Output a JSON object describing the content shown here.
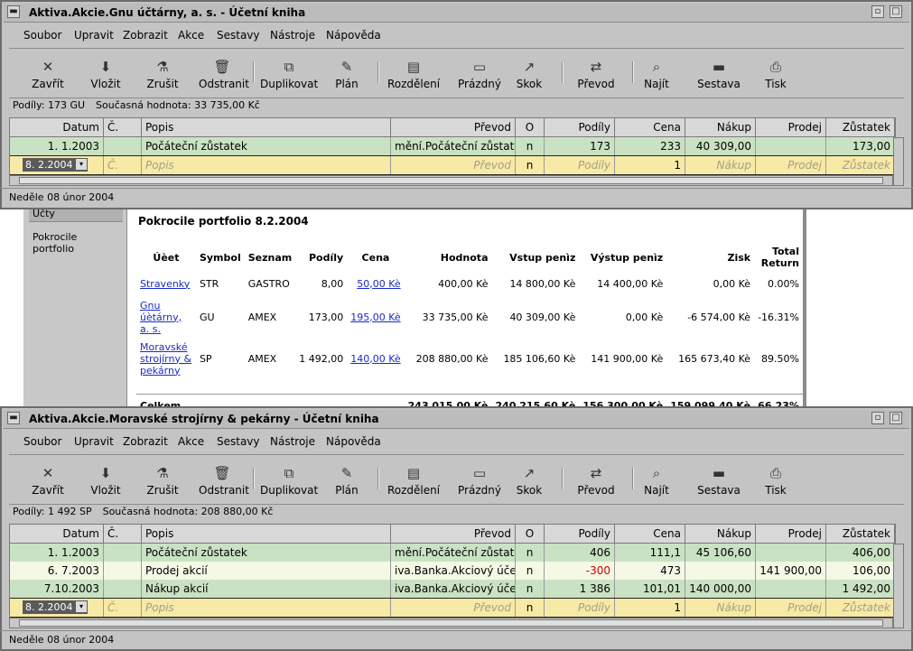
{
  "menu": [
    "Soubor",
    "Upravit",
    "Zobrazit",
    "Akce",
    "Sestavy",
    "Nástroje",
    "Nápověda"
  ],
  "toolbar": [
    {
      "label": "Zavřít",
      "icon": "close-icon"
    },
    {
      "label": "Vložit",
      "icon": "insert-icon"
    },
    {
      "label": "Zrušit",
      "icon": "cancel-icon"
    },
    {
      "label": "Odstranit",
      "icon": "delete-icon"
    },
    {
      "label": "Duplikovat",
      "icon": "duplicate-icon"
    },
    {
      "label": "Plán",
      "icon": "schedule-icon"
    },
    {
      "label": "Rozdělení",
      "icon": "split-icon"
    },
    {
      "label": "Prázdný",
      "icon": "blank-icon"
    },
    {
      "label": "Skok",
      "icon": "jump-icon"
    },
    {
      "label": "Převod",
      "icon": "transfer-icon"
    },
    {
      "label": "Najít",
      "icon": "find-icon"
    },
    {
      "label": "Sestava",
      "icon": "report-icon"
    },
    {
      "label": "Tisk",
      "icon": "print-icon"
    }
  ],
  "columns": [
    "Datum",
    "Č.",
    "Popis",
    "Převod",
    "O",
    "Podíly",
    "Cena",
    "Nákup",
    "Prodej",
    "Zůstatek"
  ],
  "windows": [
    {
      "title": "Aktiva.Akcie.Gnu účtárny, a. s. - Účetní kniha",
      "info_shares": "Podíly: 173 GU",
      "info_value": "Současná hodnota: 33 735,00 Kč",
      "rows": [
        {
          "datum": "1. 1.2003",
          "cislo": "",
          "popis": "Počáteční zůstatek",
          "prevod": "mění.Počáteční zůstatky",
          "o": "n",
          "podily": "173",
          "cena": "233",
          "nakup": "40 309,00",
          "prodej": "",
          "zustatek": "173,00"
        }
      ],
      "entry": {
        "datum": "8. 2.2004",
        "cislo": "Č.",
        "popis": "Popis",
        "prevod": "Převod",
        "o": "n",
        "podily": "Podíly",
        "cena": "1",
        "nakup": "Nákup",
        "prodej": "Prodej",
        "zustatek": "Zůstatek"
      },
      "status": "Neděle 08 únor 2004"
    },
    {
      "title": "Aktiva.Akcie.Moravské strojírny & pekárny - Účetní kniha",
      "info_shares": "Podíly: 1 492 SP",
      "info_value": "Současná hodnota: 208 880,00 Kč",
      "rows": [
        {
          "datum": "1. 1.2003",
          "cislo": "",
          "popis": "Počáteční zůstatek",
          "prevod": "mění.Počáteční zůstatky",
          "o": "n",
          "podily": "406",
          "cena": "111,1",
          "nakup": "45 106,60",
          "prodej": "",
          "zustatek": "406,00"
        },
        {
          "datum": "6. 7.2003",
          "cislo": "",
          "popis": "Prodej akcií",
          "prevod": "iva.Banka.Akciový účet",
          "o": "n",
          "podily": "-300",
          "cena": "473",
          "nakup": "",
          "prodej": "141 900,00",
          "zustatek": "106,00"
        },
        {
          "datum": "7.10.2003",
          "cislo": "",
          "popis": "Nákup akcií",
          "prevod": "iva.Banka.Akciový účet",
          "o": "n",
          "podily": "1 386",
          "cena": "101,01",
          "nakup": "140 000,00",
          "prodej": "",
          "zustatek": "1 492,00"
        }
      ],
      "entry": {
        "datum": "8. 2.2004",
        "cislo": "Č.",
        "popis": "Popis",
        "prevod": "Převod",
        "o": "n",
        "podily": "Podíly",
        "cena": "1",
        "nakup": "Nákup",
        "prodej": "Prodej",
        "zustatek": "Zůstatek"
      },
      "status": "Neděle 08 únor 2004"
    }
  ],
  "report": {
    "sidebar": [
      "Účty",
      "Pokrocile portfolio"
    ],
    "title": "Pokrocile portfolio 8.2.2004",
    "headers": [
      "Úèet",
      "Symbol",
      "Seznam",
      "Podíly",
      "Cena",
      "Hodnota",
      "Vstup penìz",
      "Výstup penìz",
      "Zisk",
      "Total Return"
    ],
    "rows": [
      {
        "ucet": "Stravenky",
        "symbol": "STR",
        "seznam": "GASTRO",
        "podily": "8,00",
        "cena": "50,00 Kè",
        "hodnota": "400,00 Kè",
        "vstup": "14 800,00 Kè",
        "vystup": "14 400,00 Kè",
        "zisk": "0,00 Kè",
        "ret": "0.00%"
      },
      {
        "ucet": "Gnu úètárny, a. s.",
        "symbol": "GU",
        "seznam": "AMEX",
        "podily": "173,00",
        "cena": "195,00 Kè",
        "hodnota": "33 735,00 Kè",
        "vstup": "40 309,00 Kè",
        "vystup": "0,00 Kè",
        "zisk": "-6 574,00 Kè",
        "ret": "-16.31%"
      },
      {
        "ucet": "Moravské strojírny & pekárny",
        "symbol": "SP",
        "seznam": "AMEX",
        "podily": "1 492,00",
        "cena": "140,00 Kè",
        "hodnota": "208 880,00 Kè",
        "vstup": "185 106,60 Kè",
        "vystup": "141 900,00 Kè",
        "zisk": "165 673,40 Kè",
        "ret": "89.50%"
      }
    ],
    "total": {
      "label": "Celkem",
      "hodnota": "243 015,00 Kè",
      "vstup": "240 215,60 Kè",
      "vystup": "156 300,00 Kè",
      "zisk": "159 099,40 Kè",
      "ret": "66.23%"
    }
  }
}
